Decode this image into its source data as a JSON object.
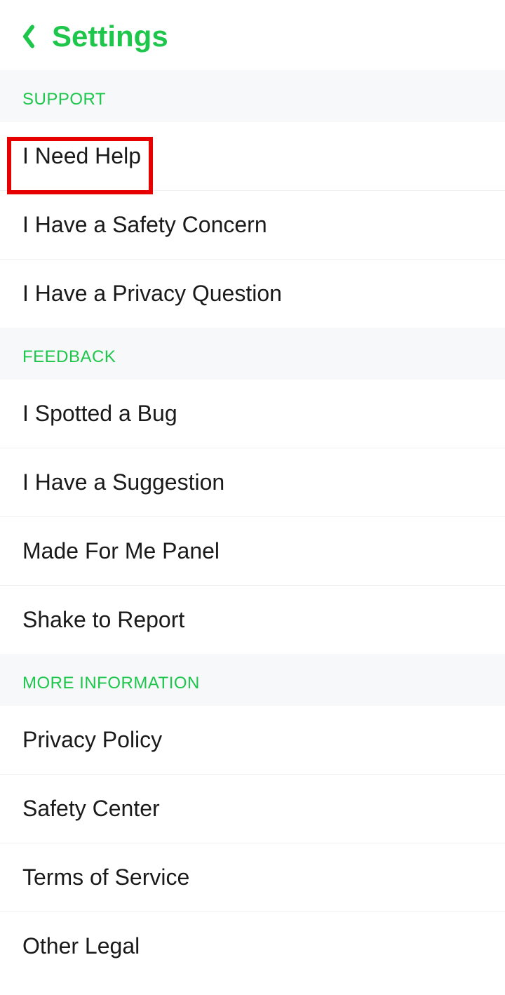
{
  "header": {
    "title": "Settings"
  },
  "sections": {
    "support": {
      "label": "SUPPORT",
      "items": [
        "I Need Help",
        "I Have a Safety Concern",
        "I Have a Privacy Question"
      ]
    },
    "feedback": {
      "label": "FEEDBACK",
      "items": [
        "I Spotted a Bug",
        "I Have a Suggestion",
        "Made For Me Panel",
        "Shake to Report"
      ]
    },
    "more": {
      "label": "MORE INFORMATION",
      "items": [
        "Privacy Policy",
        "Safety Center",
        "Terms of Service",
        "Other Legal"
      ]
    }
  },
  "highlight": {
    "target": "support-i-need-help"
  }
}
